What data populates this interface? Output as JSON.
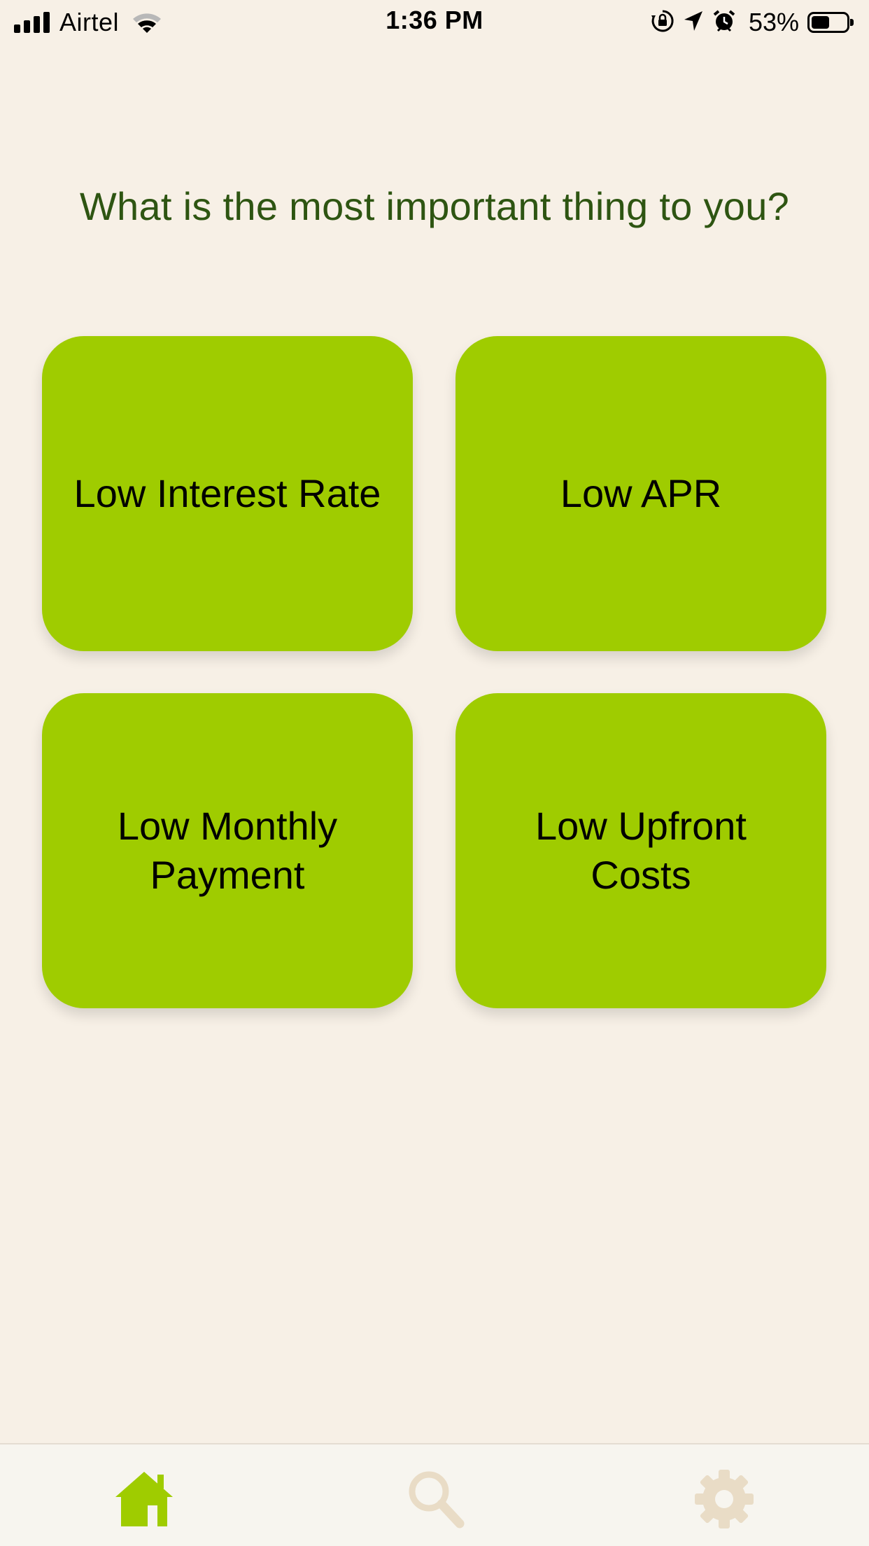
{
  "status_bar": {
    "carrier": "Airtel",
    "time": "1:36 PM",
    "battery_percent": "53%",
    "battery_level": 0.53,
    "icons": [
      "signal-icon",
      "wifi-icon",
      "orientation-lock-icon",
      "location-arrow-icon",
      "alarm-icon",
      "battery-icon"
    ]
  },
  "question": {
    "text": "What is the most important thing to you?"
  },
  "options": [
    {
      "label": "Low Interest Rate"
    },
    {
      "label": "Low APR"
    },
    {
      "label": "Low Monthly Payment"
    },
    {
      "label": "Low Upfront Costs"
    }
  ],
  "tab_bar": {
    "tabs": [
      {
        "icon": "home-icon",
        "active": true
      },
      {
        "icon": "search-icon",
        "active": false
      },
      {
        "icon": "gear-icon",
        "active": false
      }
    ]
  },
  "colors": {
    "background": "#f7f0e6",
    "card": "#9fcc00",
    "question_text": "#2e5512",
    "tab_active": "#9fcc00",
    "tab_inactive": "#e9dcc6"
  }
}
